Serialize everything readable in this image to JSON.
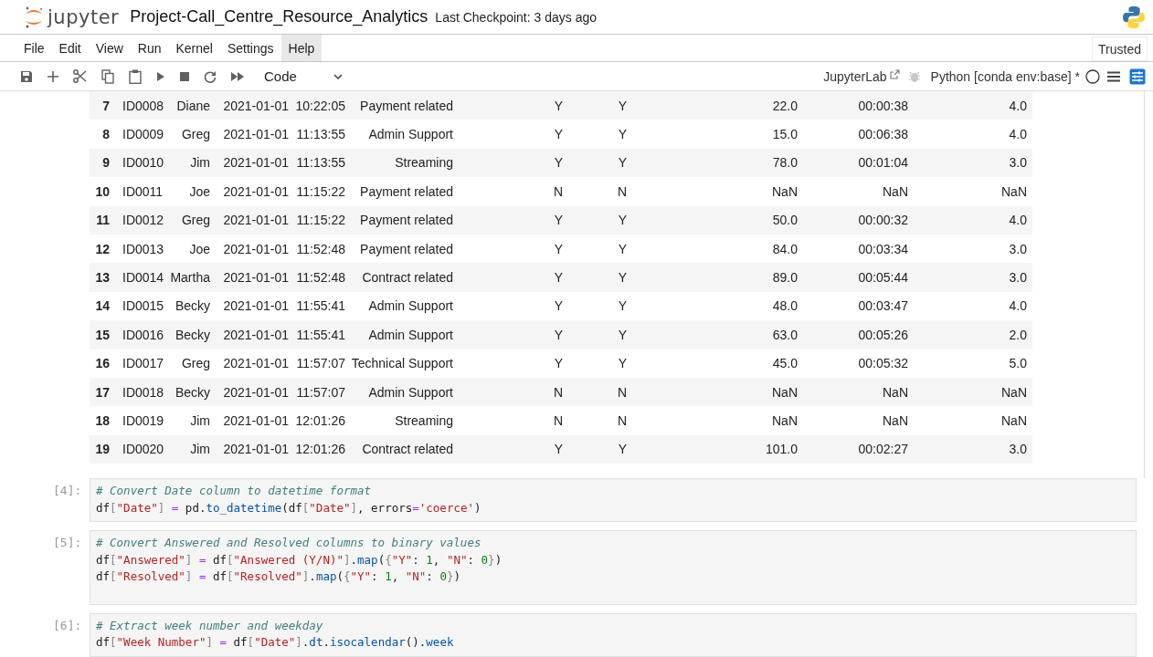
{
  "header": {
    "logo_text": "jupyter",
    "title": "Project-Call_Centre_Resource_Analytics",
    "checkpoint": "Last Checkpoint: 3 days ago"
  },
  "menu": [
    {
      "label": "File",
      "selected": false
    },
    {
      "label": "Edit",
      "selected": false
    },
    {
      "label": "View",
      "selected": false
    },
    {
      "label": "Run",
      "selected": false
    },
    {
      "label": "Kernel",
      "selected": false
    },
    {
      "label": "Settings",
      "selected": false
    },
    {
      "label": "Help",
      "selected": true
    }
  ],
  "trusted": "Trusted",
  "toolbar": {
    "cell_type": "Code",
    "lab_link": "JupyterLab",
    "kernel": "Python [conda env:base] *",
    "kernel_busy": false
  },
  "table": {
    "rows": [
      [
        "7",
        "ID0008",
        "Diane",
        "2021-01-01",
        "10:22:05",
        "Payment related",
        "Y",
        "Y",
        "22.0",
        "00:00:38",
        "4.0"
      ],
      [
        "8",
        "ID0009",
        "Greg",
        "2021-01-01",
        "11:13:55",
        "Admin Support",
        "Y",
        "Y",
        "15.0",
        "00:06:38",
        "4.0"
      ],
      [
        "9",
        "ID0010",
        "Jim",
        "2021-01-01",
        "11:13:55",
        "Streaming",
        "Y",
        "Y",
        "78.0",
        "00:01:04",
        "3.0"
      ],
      [
        "10",
        "ID0011",
        "Joe",
        "2021-01-01",
        "11:15:22",
        "Payment related",
        "N",
        "N",
        "NaN",
        "NaN",
        "NaN"
      ],
      [
        "11",
        "ID0012",
        "Greg",
        "2021-01-01",
        "11:15:22",
        "Payment related",
        "Y",
        "Y",
        "50.0",
        "00:00:32",
        "4.0"
      ],
      [
        "12",
        "ID0013",
        "Joe",
        "2021-01-01",
        "11:52:48",
        "Payment related",
        "Y",
        "Y",
        "84.0",
        "00:03:34",
        "3.0"
      ],
      [
        "13",
        "ID0014",
        "Martha",
        "2021-01-01",
        "11:52:48",
        "Contract related",
        "Y",
        "Y",
        "89.0",
        "00:05:44",
        "3.0"
      ],
      [
        "14",
        "ID0015",
        "Becky",
        "2021-01-01",
        "11:55:41",
        "Admin Support",
        "Y",
        "Y",
        "48.0",
        "00:03:47",
        "4.0"
      ],
      [
        "15",
        "ID0016",
        "Becky",
        "2021-01-01",
        "11:55:41",
        "Admin Support",
        "Y",
        "Y",
        "63.0",
        "00:05:26",
        "2.0"
      ],
      [
        "16",
        "ID0017",
        "Greg",
        "2021-01-01",
        "11:57:07",
        "Technical Support",
        "Y",
        "Y",
        "45.0",
        "00:05:32",
        "5.0"
      ],
      [
        "17",
        "ID0018",
        "Becky",
        "2021-01-01",
        "11:57:07",
        "Admin Support",
        "N",
        "N",
        "NaN",
        "NaN",
        "NaN"
      ],
      [
        "18",
        "ID0019",
        "Jim",
        "2021-01-01",
        "12:01:26",
        "Streaming",
        "N",
        "N",
        "NaN",
        "NaN",
        "NaN"
      ],
      [
        "19",
        "ID0020",
        "Jim",
        "2021-01-01",
        "12:01:26",
        "Contract related",
        "Y",
        "Y",
        "101.0",
        "00:02:27",
        "3.0"
      ]
    ]
  },
  "cells": [
    {
      "prompt": "[4]:",
      "lines": [
        [
          {
            "t": "# Convert Date column to datetime format",
            "kind": "comment"
          }
        ],
        [
          {
            "t": "df",
            "kind": "plain"
          },
          {
            "t": "[",
            "kind": "bracket"
          },
          {
            "t": "\"Date\"",
            "kind": "string"
          },
          {
            "t": "]",
            "kind": "bracket"
          },
          {
            "t": " = ",
            "kind": "op"
          },
          {
            "t": "pd.",
            "kind": "plain"
          },
          {
            "t": "to_datetime",
            "kind": "func"
          },
          {
            "t": "(df",
            "kind": "plain"
          },
          {
            "t": "[",
            "kind": "bracket"
          },
          {
            "t": "\"Date\"",
            "kind": "string"
          },
          {
            "t": "]",
            "kind": "bracket"
          },
          {
            "t": ", errors",
            "kind": "plain"
          },
          {
            "t": "=",
            "kind": "op"
          },
          {
            "t": "'coerce'",
            "kind": "string"
          },
          {
            "t": ")",
            "kind": "plain"
          }
        ]
      ]
    },
    {
      "prompt": "[5]:",
      "lines": [
        [
          {
            "t": "# Convert Answered and Resolved columns to binary values",
            "kind": "comment"
          }
        ],
        [
          {
            "t": "df",
            "kind": "plain"
          },
          {
            "t": "[",
            "kind": "bracket"
          },
          {
            "t": "\"Answered\"",
            "kind": "string"
          },
          {
            "t": "]",
            "kind": "bracket"
          },
          {
            "t": " = ",
            "kind": "op"
          },
          {
            "t": "df",
            "kind": "plain"
          },
          {
            "t": "[",
            "kind": "bracket"
          },
          {
            "t": "\"Answered (Y/N)\"",
            "kind": "string"
          },
          {
            "t": "]",
            "kind": "bracket"
          },
          {
            "t": ".",
            "kind": "plain"
          },
          {
            "t": "map",
            "kind": "func"
          },
          {
            "t": "(",
            "kind": "plain"
          },
          {
            "t": "{",
            "kind": "bracket"
          },
          {
            "t": "\"Y\"",
            "kind": "string"
          },
          {
            "t": ": ",
            "kind": "plain"
          },
          {
            "t": "1",
            "kind": "number"
          },
          {
            "t": ", ",
            "kind": "plain"
          },
          {
            "t": "\"N\"",
            "kind": "string"
          },
          {
            "t": ": ",
            "kind": "plain"
          },
          {
            "t": "0",
            "kind": "number"
          },
          {
            "t": "}",
            "kind": "bracket"
          },
          {
            "t": ")",
            "kind": "plain"
          }
        ],
        [
          {
            "t": "df",
            "kind": "plain"
          },
          {
            "t": "[",
            "kind": "bracket"
          },
          {
            "t": "\"Resolved\"",
            "kind": "string"
          },
          {
            "t": "]",
            "kind": "bracket"
          },
          {
            "t": " = ",
            "kind": "op"
          },
          {
            "t": "df",
            "kind": "plain"
          },
          {
            "t": "[",
            "kind": "bracket"
          },
          {
            "t": "\"Resolved\"",
            "kind": "string"
          },
          {
            "t": "]",
            "kind": "bracket"
          },
          {
            "t": ".",
            "kind": "plain"
          },
          {
            "t": "map",
            "kind": "func"
          },
          {
            "t": "(",
            "kind": "plain"
          },
          {
            "t": "{",
            "kind": "bracket"
          },
          {
            "t": "\"Y\"",
            "kind": "string"
          },
          {
            "t": ": ",
            "kind": "plain"
          },
          {
            "t": "1",
            "kind": "number"
          },
          {
            "t": ", ",
            "kind": "plain"
          },
          {
            "t": "\"N\"",
            "kind": "string"
          },
          {
            "t": ": ",
            "kind": "plain"
          },
          {
            "t": "0",
            "kind": "number"
          },
          {
            "t": "}",
            "kind": "bracket"
          },
          {
            "t": ")",
            "kind": "plain"
          }
        ]
      ]
    },
    {
      "prompt": "[6]:",
      "lines": [
        [
          {
            "t": "# Extract week number and weekday",
            "kind": "comment"
          }
        ],
        [
          {
            "t": "df",
            "kind": "plain"
          },
          {
            "t": "[",
            "kind": "bracket"
          },
          {
            "t": "\"Week Number\"",
            "kind": "string"
          },
          {
            "t": "]",
            "kind": "bracket"
          },
          {
            "t": " = ",
            "kind": "op"
          },
          {
            "t": "df",
            "kind": "plain"
          },
          {
            "t": "[",
            "kind": "bracket"
          },
          {
            "t": "\"Date\"",
            "kind": "string"
          },
          {
            "t": "]",
            "kind": "bracket"
          },
          {
            "t": ".",
            "kind": "plain"
          },
          {
            "t": "dt",
            "kind": "func"
          },
          {
            "t": ".",
            "kind": "plain"
          },
          {
            "t": "isocalendar",
            "kind": "func"
          },
          {
            "t": "().",
            "kind": "plain"
          },
          {
            "t": "week",
            "kind": "func"
          }
        ]
      ]
    }
  ]
}
